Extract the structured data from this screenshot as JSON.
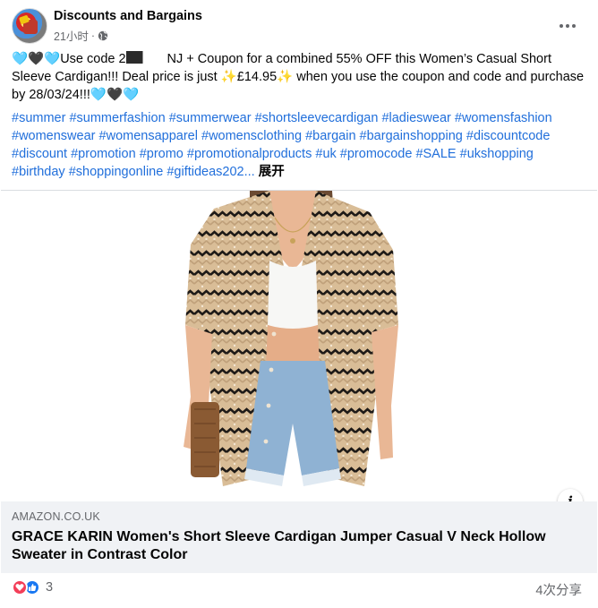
{
  "post": {
    "page_name": "Discounts and Bargains",
    "time": "21小时",
    "separator": "·",
    "text_part1": "Use code 2",
    "text_part2": "NJ + Coupon for a combined 55% OFF this Women’s Casual Short Sleeve Cardigan!!!   Deal price is just ",
    "price": "£14.95",
    "text_part3": " when you use the coupon and code and purchase by 28/03/24!!!",
    "hashtags": [
      "#summer",
      "#summerfashion",
      "#summerwear",
      "#shortsleevecardigan",
      "#ladieswear",
      "#womensfashion",
      "#womenswear",
      "#womensapparel",
      "#womensclothing",
      "#bargain",
      "#bargainshopping",
      "#discountcode",
      "#discount",
      "#promotion",
      "#promo",
      "#promotionalproducts",
      "#uk",
      "#promocode",
      "#SALE",
      "#ukshopping",
      "#birthday",
      "#shoppingonline",
      "#giftideas202..."
    ],
    "expand_label": "展开",
    "emoji": {
      "blue_heart": "🩵",
      "black_heart": "🖤",
      "sparkles": "✨"
    }
  },
  "link_preview": {
    "domain": "AMAZON.CO.UK",
    "title": "GRACE KARIN Women's Short Sleeve Cardigan Jumper Casual V Neck Hollow Sweater in Contrast Color",
    "image_icon": "product-photo-cardigan",
    "info_label": "i"
  },
  "footer": {
    "reaction_count": "3",
    "shares": "4次分享",
    "reaction_icons": [
      "love-reaction-icon",
      "like-reaction-icon"
    ]
  },
  "colors": {
    "link_blue": "#216fdb",
    "secondary_text": "#65676b",
    "caption_bg": "#f0f2f5",
    "love_red": "#f33e58",
    "like_blue": "#1877f2"
  }
}
